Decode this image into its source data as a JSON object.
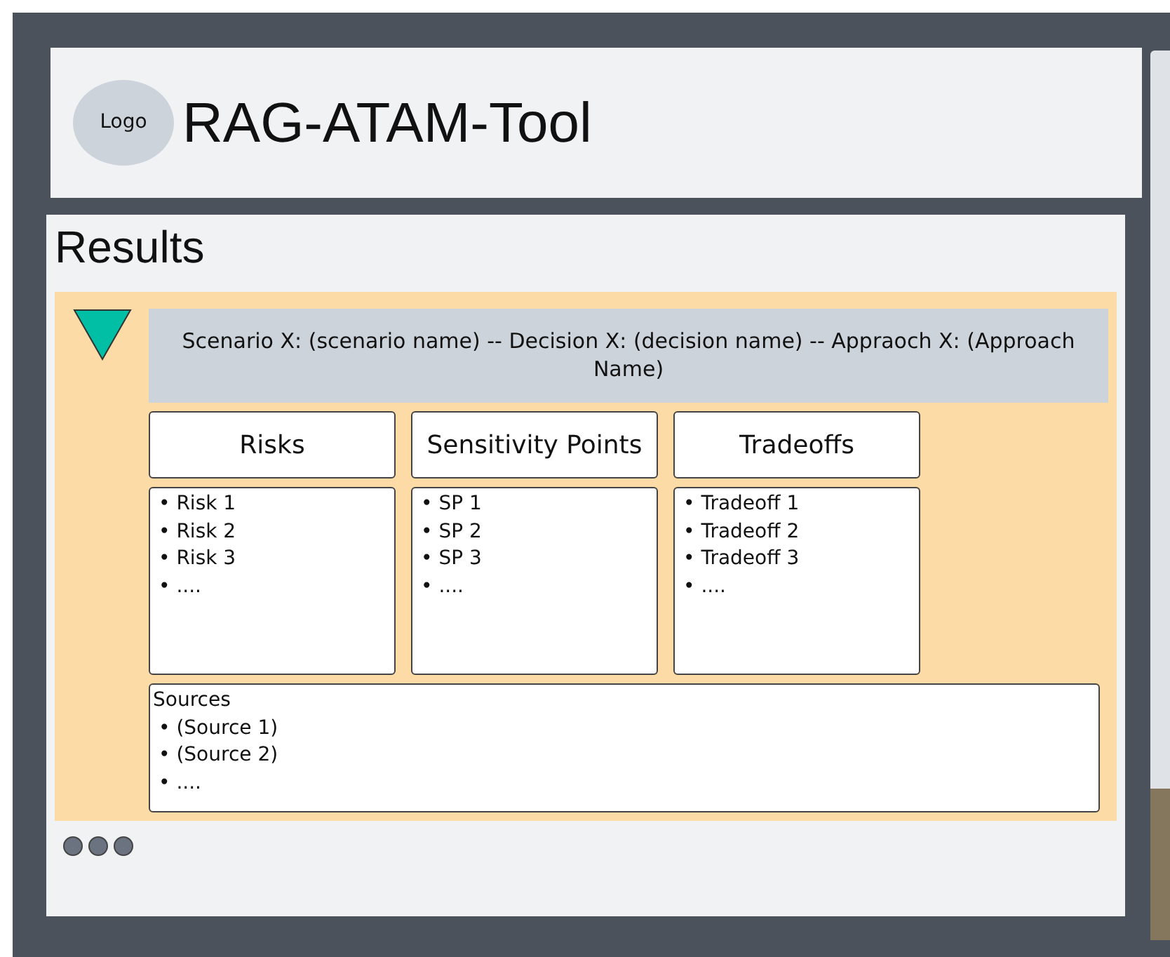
{
  "header": {
    "logo": "Logo",
    "title": "RAG-ATAM-Tool"
  },
  "results": {
    "title": "Results",
    "items": [
      {
        "expanded": true,
        "summary": "Scenario X: (scenario name) -- Decision X: (decision name) --  Appraoch X: (Approach Name)",
        "columns": [
          {
            "heading": "Risks",
            "entries": [
              "• Risk 1",
              "• Risk 2",
              "• Risk 3",
              "• ...."
            ]
          },
          {
            "heading": "Sensitivity Points",
            "entries": [
              "• SP 1",
              "• SP 2",
              "• SP 3",
              "• ...."
            ]
          },
          {
            "heading": "Tradeoffs",
            "entries": [
              "• Tradeoff 1",
              "• Tradeoff 2",
              "• Tradeoff 3",
              "• ...."
            ]
          }
        ],
        "sources": {
          "heading": "Sources",
          "entries": [
            "• (Source 1)",
            "• (Source 2)",
            "• ...."
          ]
        }
      }
    ]
  }
}
